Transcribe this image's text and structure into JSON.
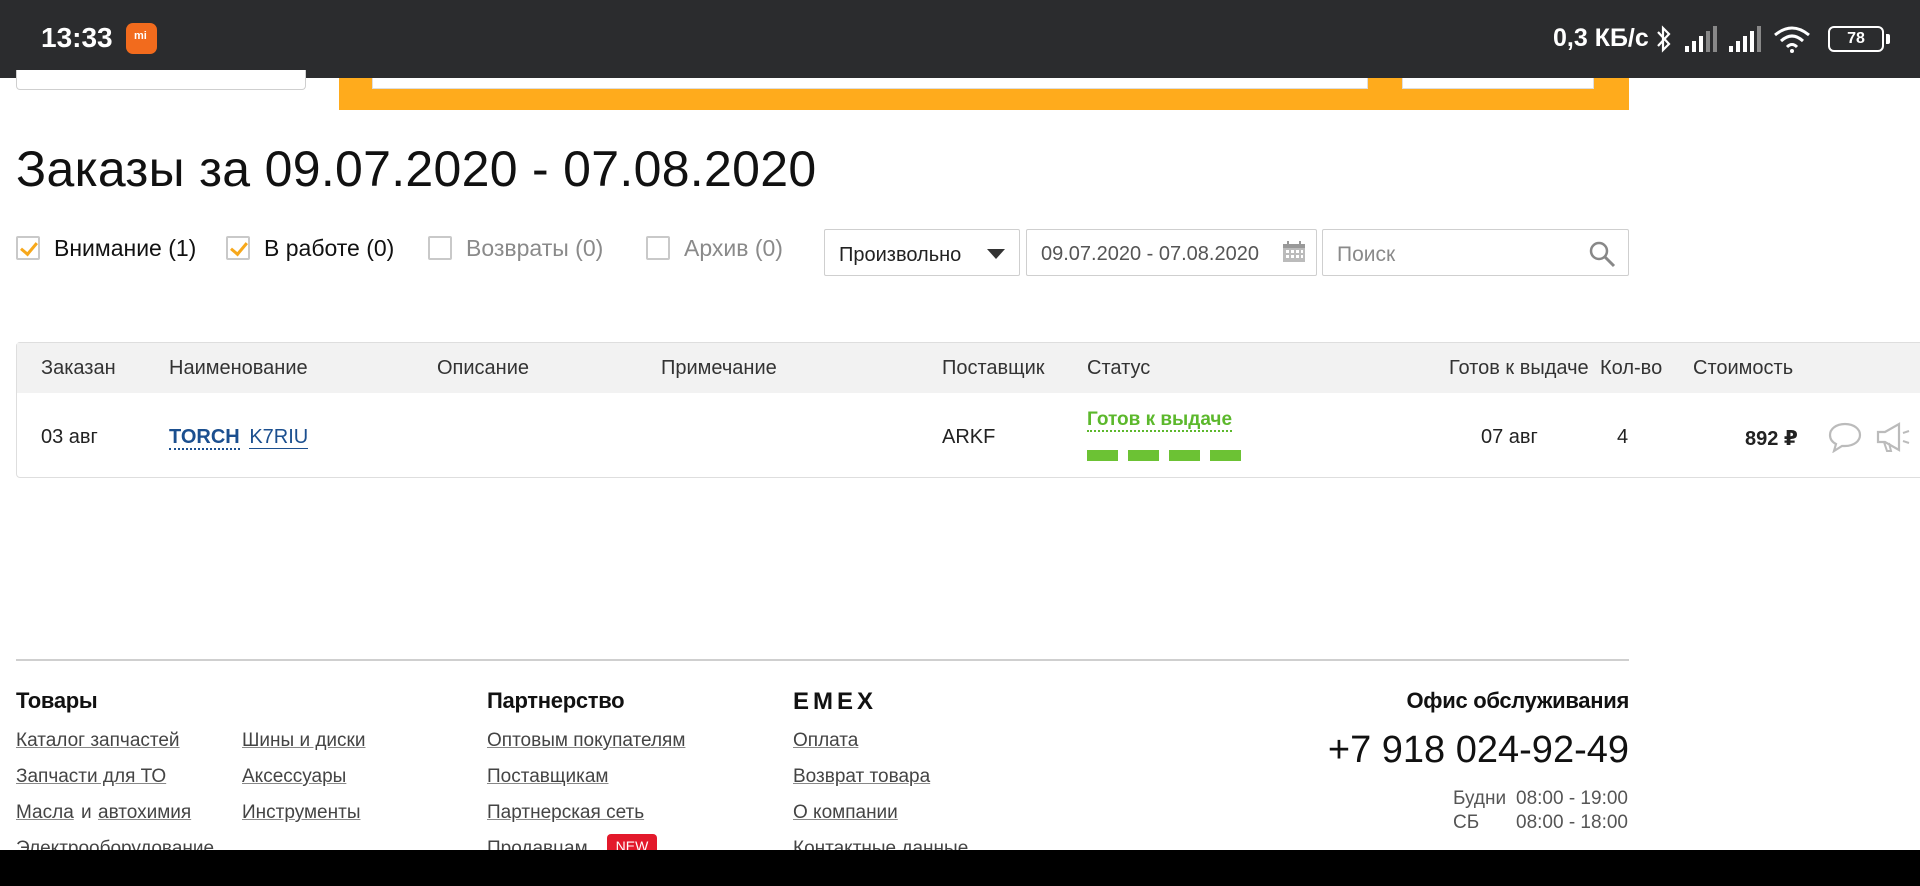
{
  "status_bar": {
    "time": "13:33",
    "speed": "0,3 КБ/с",
    "battery": "78",
    "icons": [
      "mi-app-icon",
      "bluetooth-icon",
      "signal-icon",
      "signal-icon",
      "wifi-icon",
      "battery-icon"
    ]
  },
  "page": {
    "title": "Заказы за 09.07.2020 - 07.08.2020"
  },
  "filters": [
    {
      "label": "Внимание (1)",
      "checked": true
    },
    {
      "label": "В работе (0)",
      "checked": true
    },
    {
      "label": "Возвраты (0)",
      "checked": false
    },
    {
      "label": "Архив (0)",
      "checked": false
    }
  ],
  "period_select": {
    "value": "Произвольно"
  },
  "date_range": {
    "value": "09.07.2020 - 07.08.2020"
  },
  "search": {
    "placeholder": "Поиск"
  },
  "table": {
    "headers": {
      "ordered": "Заказан",
      "name": "Наименование",
      "description": "Описание",
      "note": "Примечание",
      "supplier": "Поставщик",
      "status": "Статус",
      "ready": "Готов к выдаче",
      "qty": "Кол-во",
      "cost": "Стоимость"
    },
    "rows": [
      {
        "ordered": "03 авг",
        "brand": "TORCH",
        "article": "K7RIU",
        "description": "",
        "note": "",
        "supplier": "ARKF",
        "status": "Готов к выдаче",
        "status_progress_steps": 4,
        "status_progress_done": 4,
        "ready": "07 авг",
        "qty": "4",
        "cost": "892 ₽"
      }
    ]
  },
  "footer": {
    "col_goods": {
      "title": "Товары",
      "links": [
        "Каталог запчастей",
        "Запчасти для ТО",
        "Масла",
        "и",
        "автохимия",
        "Электрооборудование",
        "Шины и диски",
        "Аксессуары",
        "Инструменты"
      ]
    },
    "col_partner": {
      "title": "Партнерство",
      "links": [
        "Оптовым покупателям",
        "Поставщикам",
        "Партнерская сеть",
        "Продавцам"
      ],
      "badge": "NEW"
    },
    "col_emex": {
      "title": "EMEX",
      "links": [
        "Оплата",
        "Возврат товара",
        "О компании",
        "Контактные данные"
      ]
    },
    "office": {
      "title": "Офис обслуживания",
      "phone": "+7 918 024-92-49",
      "weekdays_label": "Будни",
      "weekdays_hours": "08:00 - 19:00",
      "saturday_label": "СБ",
      "saturday_hours": "08:00 - 18:00"
    }
  },
  "colors": {
    "accent_orange": "#ffab1c",
    "status_green": "#5cb82c",
    "link_blue": "#1b4f8f",
    "badge_red": "#e3192b"
  }
}
